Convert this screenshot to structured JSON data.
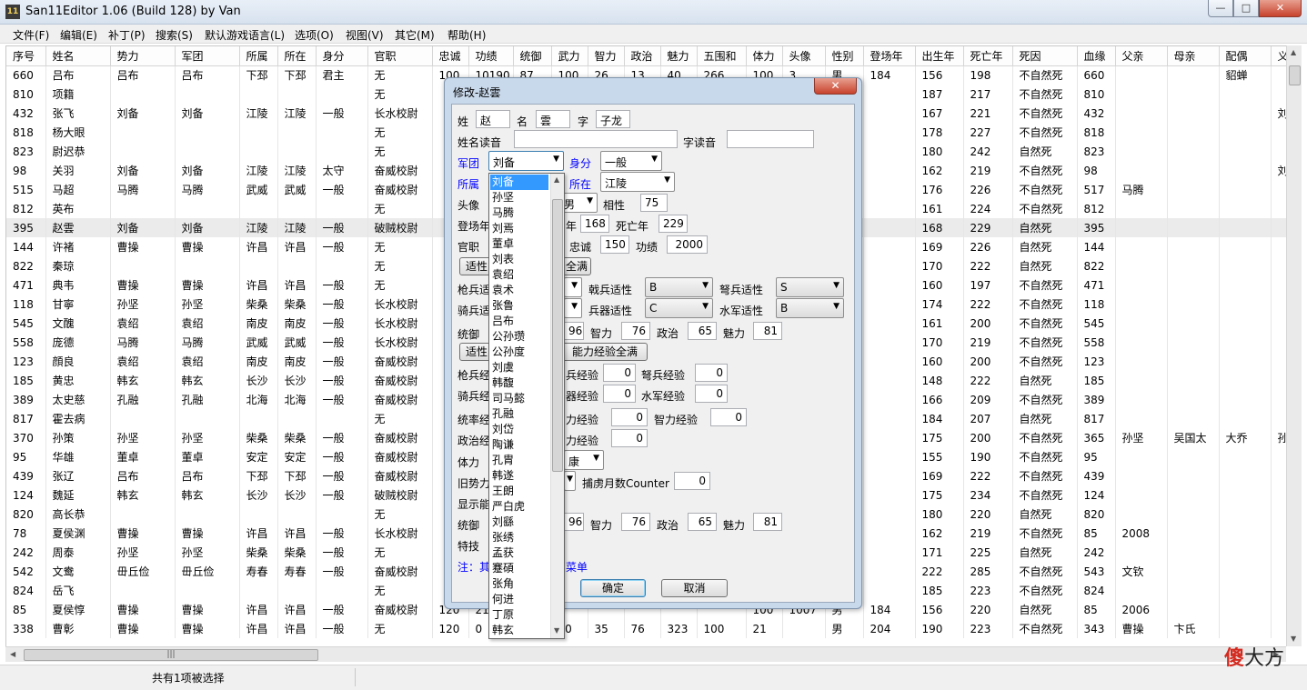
{
  "window": {
    "title": "San11Editor 1.06 (Build 128) by Van",
    "icon": "11"
  },
  "menu": [
    "文件(F)",
    "编辑(E)",
    "补丁(P)",
    "搜索(S)",
    "默认游戏语言(L)",
    "选项(O)",
    "视图(V)",
    "其它(M)",
    "帮助(H)"
  ],
  "table": {
    "columns": [
      "序号",
      "姓名",
      "势力",
      "军团",
      "所属",
      "所在",
      "身分",
      "官职",
      "忠诚",
      "功绩",
      "统御",
      "武力",
      "智力",
      "政治",
      "魅力",
      "五围和",
      "体力",
      "头像",
      "性别",
      "登场年",
      "出生年",
      "死亡年",
      "死因",
      "血缘",
      "父亲",
      "母亲",
      "配偶",
      "义兄弟"
    ],
    "rows": [
      [
        "660",
        "吕布",
        "吕布",
        "吕布",
        "下邳",
        "下邳",
        "君主",
        "无",
        "100",
        "10190",
        "87",
        "100",
        "26",
        "13",
        "40",
        "266",
        "100",
        "3",
        "男",
        "184",
        "156",
        "198",
        "不自然死",
        "660",
        "",
        "",
        "貂蝉",
        ""
      ],
      [
        "810",
        "项籍",
        "",
        "",
        "",
        "",
        "",
        "无",
        "",
        "",
        "",
        "",
        "",
        "",
        "",
        "",
        "",
        "",
        "",
        "",
        "187",
        "217",
        "不自然死",
        "810",
        "",
        "",
        "",
        ""
      ],
      [
        "432",
        "张飞",
        "刘备",
        "刘备",
        "江陵",
        "江陵",
        "一般",
        "长水校尉",
        "",
        "",
        "",
        "",
        "",
        "",
        "",
        "",
        "",
        "",
        "",
        "",
        "167",
        "221",
        "不自然死",
        "432",
        "",
        "",
        "",
        "刘备"
      ],
      [
        "818",
        "杨大眼",
        "",
        "",
        "",
        "",
        "",
        "无",
        "",
        "",
        "",
        "",
        "",
        "",
        "",
        "",
        "",
        "",
        "",
        "",
        "178",
        "227",
        "不自然死",
        "818",
        "",
        "",
        "",
        ""
      ],
      [
        "823",
        "尉迟恭",
        "",
        "",
        "",
        "",
        "",
        "无",
        "",
        "",
        "",
        "",
        "",
        "",
        "",
        "",
        "",
        "",
        "",
        "",
        "180",
        "242",
        "自然死",
        "823",
        "",
        "",
        "",
        ""
      ],
      [
        "98",
        "关羽",
        "刘备",
        "刘备",
        "江陵",
        "江陵",
        "太守",
        "奋威校尉",
        "",
        "",
        "",
        "",
        "",
        "",
        "",
        "",
        "",
        "",
        "",
        "",
        "162",
        "219",
        "不自然死",
        "98",
        "",
        "",
        "",
        "刘备"
      ],
      [
        "515",
        "马超",
        "马腾",
        "马腾",
        "武威",
        "武威",
        "一般",
        "奋威校尉",
        "",
        "",
        "",
        "",
        "",
        "",
        "",
        "",
        "",
        "",
        "",
        "",
        "176",
        "226",
        "不自然死",
        "517",
        "马腾",
        "",
        "",
        ""
      ],
      [
        "812",
        "英布",
        "",
        "",
        "",
        "",
        "",
        "无",
        "",
        "",
        "",
        "",
        "",
        "",
        "",
        "",
        "",
        "",
        "",
        "",
        "161",
        "224",
        "不自然死",
        "812",
        "",
        "",
        "",
        ""
      ],
      [
        "395",
        "赵雲",
        "刘备",
        "刘备",
        "江陵",
        "江陵",
        "一般",
        "破贼校尉",
        "",
        "",
        "",
        "",
        "",
        "",
        "",
        "",
        "",
        "",
        "",
        "",
        "168",
        "229",
        "自然死",
        "395",
        "",
        "",
        "",
        ""
      ],
      [
        "144",
        "许褚",
        "曹操",
        "曹操",
        "许昌",
        "许昌",
        "一般",
        "无",
        "",
        "",
        "",
        "",
        "",
        "",
        "",
        "",
        "",
        "",
        "",
        "",
        "169",
        "226",
        "自然死",
        "144",
        "",
        "",
        "",
        ""
      ],
      [
        "822",
        "秦琼",
        "",
        "",
        "",
        "",
        "",
        "无",
        "",
        "",
        "",
        "",
        "",
        "",
        "",
        "",
        "",
        "",
        "",
        "",
        "170",
        "222",
        "自然死",
        "822",
        "",
        "",
        "",
        ""
      ],
      [
        "471",
        "典韦",
        "曹操",
        "曹操",
        "许昌",
        "许昌",
        "一般",
        "无",
        "",
        "",
        "",
        "",
        "",
        "",
        "",
        "",
        "",
        "",
        "",
        "",
        "160",
        "197",
        "不自然死",
        "471",
        "",
        "",
        "",
        ""
      ],
      [
        "118",
        "甘寧",
        "孙坚",
        "孙坚",
        "柴桑",
        "柴桑",
        "一般",
        "长水校尉",
        "",
        "",
        "",
        "",
        "",
        "",
        "",
        "",
        "",
        "",
        "",
        "",
        "174",
        "222",
        "不自然死",
        "118",
        "",
        "",
        "",
        ""
      ],
      [
        "545",
        "文醜",
        "袁绍",
        "袁绍",
        "南皮",
        "南皮",
        "一般",
        "长水校尉",
        "",
        "",
        "",
        "",
        "",
        "",
        "",
        "",
        "",
        "",
        "",
        "",
        "161",
        "200",
        "不自然死",
        "545",
        "",
        "",
        "",
        ""
      ],
      [
        "558",
        "庞德",
        "马腾",
        "马腾",
        "武威",
        "武威",
        "一般",
        "长水校尉",
        "",
        "",
        "",
        "",
        "",
        "",
        "",
        "",
        "",
        "",
        "",
        "",
        "170",
        "219",
        "不自然死",
        "558",
        "",
        "",
        "",
        ""
      ],
      [
        "123",
        "顔良",
        "袁绍",
        "袁绍",
        "南皮",
        "南皮",
        "一般",
        "奋威校尉",
        "",
        "",
        "",
        "",
        "",
        "",
        "",
        "",
        "",
        "",
        "",
        "",
        "160",
        "200",
        "不自然死",
        "123",
        "",
        "",
        "",
        ""
      ],
      [
        "185",
        "黄忠",
        "韩玄",
        "韩玄",
        "长沙",
        "长沙",
        "一般",
        "奋威校尉",
        "",
        "",
        "",
        "",
        "",
        "",
        "",
        "",
        "",
        "",
        "",
        "",
        "148",
        "222",
        "自然死",
        "185",
        "",
        "",
        "",
        ""
      ],
      [
        "389",
        "太史慈",
        "孔融",
        "孔融",
        "北海",
        "北海",
        "一般",
        "奋威校尉",
        "",
        "",
        "",
        "",
        "",
        "",
        "",
        "",
        "",
        "",
        "",
        "",
        "166",
        "209",
        "不自然死",
        "389",
        "",
        "",
        "",
        ""
      ],
      [
        "817",
        "霍去病",
        "",
        "",
        "",
        "",
        "",
        "无",
        "",
        "",
        "",
        "",
        "",
        "",
        "",
        "",
        "",
        "",
        "",
        "",
        "184",
        "207",
        "自然死",
        "817",
        "",
        "",
        "",
        ""
      ],
      [
        "370",
        "孙策",
        "孙坚",
        "孙坚",
        "柴桑",
        "柴桑",
        "一般",
        "奋威校尉",
        "",
        "",
        "",
        "",
        "",
        "",
        "",
        "",
        "",
        "",
        "",
        "",
        "175",
        "200",
        "不自然死",
        "365",
        "孙坚",
        "吴国太",
        "大乔",
        "孙策"
      ],
      [
        "95",
        "华雄",
        "董卓",
        "董卓",
        "安定",
        "安定",
        "一般",
        "奋威校尉",
        "",
        "",
        "",
        "",
        "",
        "",
        "",
        "",
        "",
        "",
        "",
        "",
        "155",
        "190",
        "不自然死",
        "95",
        "",
        "",
        "",
        ""
      ],
      [
        "439",
        "张辽",
        "吕布",
        "吕布",
        "下邳",
        "下邳",
        "一般",
        "奋威校尉",
        "",
        "",
        "",
        "",
        "",
        "",
        "",
        "",
        "",
        "",
        "",
        "",
        "169",
        "222",
        "不自然死",
        "439",
        "",
        "",
        "",
        ""
      ],
      [
        "124",
        "魏延",
        "韩玄",
        "韩玄",
        "长沙",
        "长沙",
        "一般",
        "破贼校尉",
        "",
        "",
        "",
        "",
        "",
        "",
        "",
        "",
        "",
        "",
        "",
        "",
        "175",
        "234",
        "不自然死",
        "124",
        "",
        "",
        "",
        ""
      ],
      [
        "820",
        "高长恭",
        "",
        "",
        "",
        "",
        "",
        "无",
        "",
        "",
        "",
        "",
        "",
        "",
        "",
        "",
        "",
        "",
        "",
        "",
        "180",
        "220",
        "自然死",
        "820",
        "",
        "",
        "",
        ""
      ],
      [
        "78",
        "夏侯渊",
        "曹操",
        "曹操",
        "许昌",
        "许昌",
        "一般",
        "长水校尉",
        "",
        "",
        "",
        "",
        "",
        "",
        "",
        "",
        "",
        "",
        "",
        "",
        "162",
        "219",
        "不自然死",
        "85",
        "2008",
        "",
        "",
        ""
      ],
      [
        "242",
        "周泰",
        "孙坚",
        "孙坚",
        "柴桑",
        "柴桑",
        "一般",
        "无",
        "",
        "",
        "",
        "",
        "",
        "",
        "",
        "",
        "",
        "",
        "",
        "",
        "171",
        "225",
        "自然死",
        "242",
        "",
        "",
        "",
        ""
      ],
      [
        "542",
        "文鸯",
        "毌丘俭",
        "毌丘俭",
        "寿春",
        "寿春",
        "一般",
        "奋威校尉",
        "",
        "",
        "",
        "",
        "",
        "",
        "",
        "",
        "",
        "",
        "",
        "",
        "222",
        "285",
        "不自然死",
        "543",
        "文钦",
        "",
        "",
        ""
      ],
      [
        "824",
        "岳飞",
        "",
        "",
        "",
        "",
        "",
        "无",
        "",
        "",
        "",
        "",
        "",
        "",
        "",
        "",
        "",
        "",
        "",
        "",
        "185",
        "223",
        "不自然死",
        "824",
        "",
        "",
        "",
        ""
      ],
      [
        "85",
        "夏侯惇",
        "曹操",
        "曹操",
        "许昌",
        "许昌",
        "一般",
        "奋威校尉",
        "120",
        "21",
        "",
        "",
        "",
        "",
        "",
        "",
        "100",
        "1007",
        "男",
        "184",
        "156",
        "220",
        "自然死",
        "85",
        "2006",
        "",
        "",
        ""
      ],
      [
        "338",
        "曹彰",
        "曹操",
        "曹操",
        "许昌",
        "许昌",
        "一般",
        "无",
        "120",
        "0",
        "",
        "40",
        "35",
        "76",
        "323",
        "100",
        "21",
        "",
        "男",
        "204",
        "190",
        "223",
        "不自然死",
        "343",
        "曹操",
        "卞氏",
        "",
        ""
      ]
    ],
    "selected_row": 8
  },
  "status": {
    "text": "共有1项被选择"
  },
  "watermark": {
    "part1": "傻",
    "part2": "大方"
  },
  "dialog": {
    "title": "修改-赵雲",
    "fields": {
      "surname_label": "姓",
      "surname": "赵",
      "given_label": "名",
      "given": "雲",
      "style_label": "字",
      "style": "子龙",
      "reading_label": "姓名读音",
      "reading": "",
      "style_reading_label": "字读音",
      "style_reading": "",
      "corps_label": "军团",
      "corps": "刘备",
      "status_label": "身分",
      "status": "一般",
      "belong_label": "所属",
      "location_label": "所在",
      "location": "江陵",
      "portrait_label": "头像",
      "gender": "男",
      "affinity_label": "相性",
      "affinity": "75",
      "debut_label": "登场年",
      "birth_suffix": "年",
      "birth": "168",
      "death_label": "死亡年",
      "death": "229",
      "rank_label": "官职",
      "loyalty_label": "忠诚",
      "loyalty": "150",
      "merit_label": "功绩",
      "merit": "2000",
      "aptitude_btn": "适性",
      "aptitude_full_btn": "全满",
      "spear_label": "枪兵适",
      "halberd_label": "戟兵适性",
      "halberd": "B",
      "crossbow_label": "弩兵适性",
      "crossbow": "S",
      "cavalry_label": "骑兵适",
      "siege_label": "兵器适性",
      "siege": "C",
      "navy_label": "水军适性",
      "navy": "B",
      "lead_label": "统御",
      "war": "96",
      "int_label": "智力",
      "int": "76",
      "pol_label": "政治",
      "pol": "65",
      "cha_label": "魅力",
      "cha": "81",
      "aptitude2_btn": "适性",
      "ability_exp_full_btn": "能力经验全满",
      "spear_exp_label": "枪兵经",
      "halberd_exp_label": "兵经验",
      "halberd_exp": "0",
      "crossbow_exp_label": "弩兵经验",
      "crossbow_exp": "0",
      "cavalry_exp_label": "骑兵经",
      "siege_exp_label": "器经验",
      "siege_exp": "0",
      "navy_exp_label": "水军经验",
      "navy_exp": "0",
      "lead_exp_label": "统率经",
      "war_exp_label": "力经验",
      "war_exp": "0",
      "int_exp_label": "智力经验",
      "int_exp": "0",
      "pol_exp_label": "政治经",
      "cha_exp_label": "力经验",
      "cha_exp": "0",
      "stamina_label": "体力",
      "health": "康",
      "old_force_label": "旧势力",
      "capture_label": "捕虏月数Counter",
      "capture": "0",
      "show_label": "显示能",
      "lead2_label": "统御",
      "war2": "96",
      "int2_label": "智力",
      "int2": "76",
      "pol2_label": "政治",
      "pol2": "65",
      "cha2_label": "魅力",
      "cha2": "81",
      "skill_label": "特技",
      "note": "注：其",
      "note_tail": "菜单",
      "ok_btn": "确定",
      "cancel_btn": "取消"
    }
  },
  "droplist": {
    "items": [
      "刘备",
      "孙坚",
      "马腾",
      "刘焉",
      "董卓",
      "刘表",
      "袁绍",
      "袁术",
      "张鲁",
      "吕布",
      "公孙瓒",
      "公孙度",
      "刘虞",
      "韩馥",
      "司马懿",
      "孔融",
      "刘岱",
      "陶谦",
      "孔胄",
      "韩遂",
      "王朗",
      "严白虎",
      "刘繇",
      "张绣",
      "孟获",
      "蹇碩",
      "张角",
      "何进",
      "丁原",
      "韩玄"
    ],
    "highlighted": 0
  }
}
